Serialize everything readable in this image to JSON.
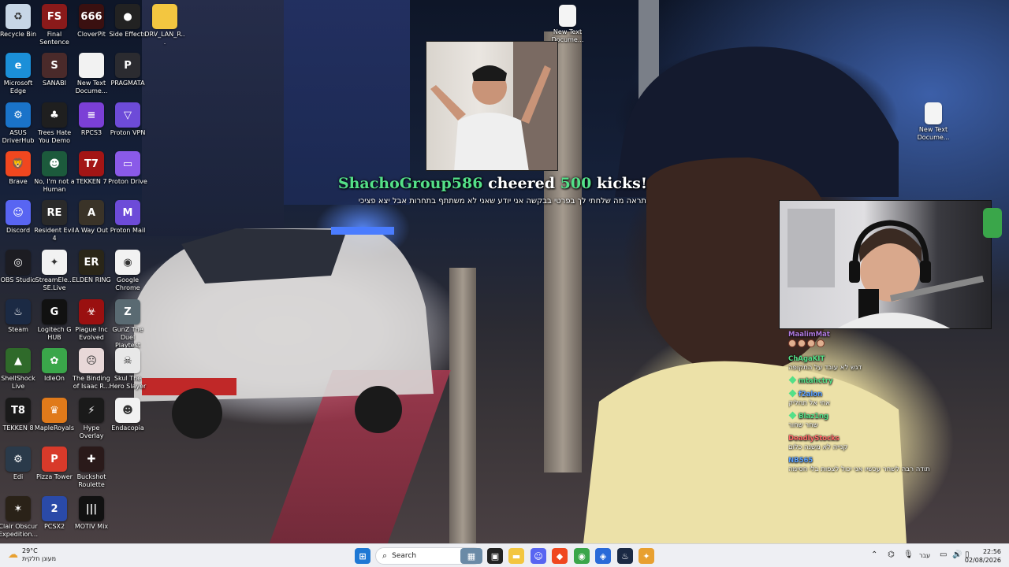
{
  "desktop_icons": [
    {
      "label": "Recycle Bin",
      "icon": "recycle-bin-icon",
      "color": "#c7d6e6",
      "glyph": "♻",
      "col": 0,
      "row": 0
    },
    {
      "label": "Final Sentence",
      "icon": "final-sentence-icon",
      "color": "#8a1a1a",
      "glyph": "FS",
      "col": 1,
      "row": 0
    },
    {
      "label": "CloverPit",
      "icon": "cloverpit-icon",
      "color": "#3a1010",
      "glyph": "666",
      "col": 2,
      "row": 0
    },
    {
      "label": "Side Effects",
      "icon": "side-effects-icon",
      "color": "#222222",
      "glyph": "●",
      "col": 3,
      "row": 0
    },
    {
      "label": "DRV_LAN_R...",
      "icon": "folder-icon",
      "color": "#f3c640",
      "glyph": "",
      "col": 4,
      "row": 0
    },
    {
      "label": "Microsoft Edge",
      "icon": "edge-icon",
      "color": "#1b8fd8",
      "glyph": "e",
      "col": 0,
      "row": 1
    },
    {
      "label": "SANABI",
      "icon": "sanabi-icon",
      "color": "#4a2a2a",
      "glyph": "S",
      "col": 1,
      "row": 1
    },
    {
      "label": "New Text Docume...",
      "icon": "text-document-icon",
      "color": "#f2f2f2",
      "glyph": "",
      "col": 2,
      "row": 1
    },
    {
      "label": "PRAGMATA",
      "icon": "pragmata-icon",
      "color": "#2b2b30",
      "glyph": "P",
      "col": 3,
      "row": 1
    },
    {
      "label": "ASUS DriverHub",
      "icon": "asus-driverhub-icon",
      "color": "#1a73c9",
      "glyph": "⚙",
      "col": 0,
      "row": 2
    },
    {
      "label": "Trees Hate You Demo",
      "icon": "trees-hate-you-icon",
      "color": "#1f1f1f",
      "glyph": "♣",
      "col": 1,
      "row": 2
    },
    {
      "label": "RPCS3",
      "icon": "rpcs3-icon",
      "color": "#7b3fd6",
      "glyph": "≡",
      "col": 2,
      "row": 2
    },
    {
      "label": "Proton VPN",
      "icon": "proton-vpn-icon",
      "color": "#6d4bd8",
      "glyph": "▽",
      "col": 3,
      "row": 2
    },
    {
      "label": "Brave",
      "icon": "brave-icon",
      "color": "#f0471f",
      "glyph": "🦁",
      "col": 0,
      "row": 3
    },
    {
      "label": "No, I'm not a Human",
      "icon": "no-im-not-human-icon",
      "color": "#1c5a3c",
      "glyph": "☻",
      "col": 1,
      "row": 3
    },
    {
      "label": "TEKKEN 7",
      "icon": "tekken7-icon",
      "color": "#a31515",
      "glyph": "T7",
      "col": 2,
      "row": 3
    },
    {
      "label": "Proton Drive",
      "icon": "proton-drive-icon",
      "color": "#8a5ae8",
      "glyph": "▭",
      "col": 3,
      "row": 3
    },
    {
      "label": "Discord",
      "icon": "discord-icon",
      "color": "#5865f2",
      "glyph": "☺",
      "col": 0,
      "row": 4
    },
    {
      "label": "Resident Evil 4",
      "icon": "resident-evil4-icon",
      "color": "#2a2a2a",
      "glyph": "RE",
      "col": 1,
      "row": 4
    },
    {
      "label": "A Way Out",
      "icon": "a-way-out-icon",
      "color": "#3a3328",
      "glyph": "A",
      "col": 2,
      "row": 4
    },
    {
      "label": "Proton Mail",
      "icon": "proton-mail-icon",
      "color": "#6d4bd8",
      "glyph": "M",
      "col": 3,
      "row": 4
    },
    {
      "label": "OBS Studio",
      "icon": "obs-studio-icon",
      "color": "#1c1c22",
      "glyph": "◎",
      "col": 0,
      "row": 5
    },
    {
      "label": "StreamEle... SE.Live",
      "icon": "streamelements-icon",
      "color": "#f2f2f2",
      "glyph": "✦",
      "col": 1,
      "row": 5
    },
    {
      "label": "ELDEN RING",
      "icon": "elden-ring-icon",
      "color": "#2a2618",
      "glyph": "ER",
      "col": 2,
      "row": 5
    },
    {
      "label": "Google Chrome",
      "icon": "chrome-icon",
      "color": "#f2f2f2",
      "glyph": "◉",
      "col": 3,
      "row": 5
    },
    {
      "label": "Steam",
      "icon": "steam-icon",
      "color": "#1b2a44",
      "glyph": "♨",
      "col": 0,
      "row": 6
    },
    {
      "label": "Logitech G HUB",
      "icon": "logitech-ghub-icon",
      "color": "#111111",
      "glyph": "G",
      "col": 1,
      "row": 6
    },
    {
      "label": "Plague Inc Evolved",
      "icon": "plague-inc-icon",
      "color": "#9a1010",
      "glyph": "☣",
      "col": 2,
      "row": 6
    },
    {
      "label": "GunZ The Duel Playtest",
      "icon": "gunz-icon",
      "color": "#5a6a72",
      "glyph": "Z",
      "col": 3,
      "row": 6
    },
    {
      "label": "ShellShock Live",
      "icon": "shellshock-live-icon",
      "color": "#2f6a2a",
      "glyph": "▲",
      "col": 0,
      "row": 7
    },
    {
      "label": "IdleOn",
      "icon": "idleon-icon",
      "color": "#3aa64a",
      "glyph": "✿",
      "col": 1,
      "row": 7
    },
    {
      "label": "The Binding of Isaac R...",
      "icon": "binding-of-isaac-icon",
      "color": "#e8d8d8",
      "glyph": "☹",
      "col": 2,
      "row": 7
    },
    {
      "label": "Skul The Hero Slayer",
      "icon": "skul-icon",
      "color": "#e8e8e8",
      "glyph": "☠",
      "col": 3,
      "row": 7
    },
    {
      "label": "TEKKEN 8",
      "icon": "tekken8-icon",
      "color": "#1a1a1a",
      "glyph": "T8",
      "col": 0,
      "row": 8
    },
    {
      "label": "MapleRoyals",
      "icon": "mapleroyals-icon",
      "color": "#e07a1a",
      "glyph": "♛",
      "col": 1,
      "row": 8
    },
    {
      "label": "Hype Overlay",
      "icon": "hype-overlay-icon",
      "color": "#1a1a1a",
      "glyph": "⚡",
      "col": 2,
      "row": 8
    },
    {
      "label": "Endacopia",
      "icon": "endacopia-icon",
      "color": "#f2f2f2",
      "glyph": "☻",
      "col": 3,
      "row": 8
    },
    {
      "label": "Edi",
      "icon": "edi-icon",
      "color": "#2a3a4a",
      "glyph": "⚙",
      "col": 0,
      "row": 9
    },
    {
      "label": "Pizza Tower",
      "icon": "pizza-tower-icon",
      "color": "#d83a2a",
      "glyph": "P",
      "col": 1,
      "row": 9
    },
    {
      "label": "Buckshot Roulette",
      "icon": "buckshot-roulette-icon",
      "color": "#2a1a1a",
      "glyph": "✚",
      "col": 2,
      "row": 9
    },
    {
      "label": "Clair Obscur Expedition...",
      "icon": "clair-obscur-icon",
      "color": "#2a2218",
      "glyph": "✶",
      "col": 0,
      "row": 10
    },
    {
      "label": "PCSX2",
      "icon": "pcsx2-icon",
      "color": "#2a4aa8",
      "glyph": "2",
      "col": 1,
      "row": 10
    },
    {
      "label": "MOTIV Mix",
      "icon": "motiv-mix-icon",
      "color": "#111111",
      "glyph": "|||",
      "col": 2,
      "row": 10
    }
  ],
  "extra_icons": [
    {
      "label": "New Text Docume...",
      "icon": "text-document-icon"
    },
    {
      "label": "New Text Docume...",
      "icon": "text-document-icon"
    }
  ],
  "cheer": {
    "user": "ShachoGroup586",
    "word1": "cheered",
    "amount": "500",
    "word2": "kicks!",
    "message": "תראה מה שלחתי לך בפרטי בבקשה אני יודע שאני לא משתתף בתחרות אבל יצא פציכי"
  },
  "chat": [
    {
      "user": "MaalimMat",
      "color": "#b07ae0",
      "text": "",
      "emotes": 4,
      "badge": false
    },
    {
      "user": "ChAgaKIT",
      "color": "#54e088",
      "text": "דגש לא עובד על התקופה",
      "emotes": 0,
      "badge": false
    },
    {
      "user": "mtahctry",
      "color": "#54e088",
      "text": "",
      "emotes": 0,
      "badge": true
    },
    {
      "user": "f2alon",
      "color": "#5aa0ff",
      "text": "אחי אל תחליק",
      "emotes": 0,
      "badge": true
    },
    {
      "user": "Blaz1ng",
      "color": "#54e088",
      "text": "שחר שחור",
      "emotes": 0,
      "badge": true
    },
    {
      "user": "DeadlyStocks",
      "color": "#ff6a6a",
      "text": "קנייה לא משנה כלום",
      "emotes": 0,
      "badge": false
    },
    {
      "user": "NB565",
      "color": "#5aa0ff",
      "text": "תודה רבה לשחר עכשיו אני יכול לצפות בלי חסימה",
      "emotes": 0,
      "badge": false
    }
  ],
  "taskbar": {
    "search_placeholder": "Search",
    "weather_temp": "29°C",
    "weather_desc": "מעונן חלקית",
    "language": "עבר",
    "time": "22:56",
    "date": "02/08/2026",
    "apps": [
      {
        "icon": "start-icon",
        "color": "#1e78d4",
        "glyph": "⊞"
      },
      {
        "icon": "widgets-icon",
        "color": "#6a8aa6",
        "glyph": "▦"
      },
      {
        "icon": "task-view-icon",
        "color": "#222222",
        "glyph": "▣"
      },
      {
        "icon": "file-explorer-icon",
        "color": "#f3c640",
        "glyph": "▬"
      },
      {
        "icon": "discord-taskbar-icon",
        "color": "#5865f2",
        "glyph": "☺"
      },
      {
        "icon": "brave-taskbar-icon",
        "color": "#f0471f",
        "glyph": "◆"
      },
      {
        "icon": "chrome-taskbar-icon",
        "color": "#3aa64a",
        "glyph": "◉"
      },
      {
        "icon": "app-taskbar-icon",
        "color": "#2a6ad8",
        "glyph": "◈"
      },
      {
        "icon": "steam-taskbar-icon",
        "color": "#1b2a44",
        "glyph": "♨"
      },
      {
        "icon": "streamelements-taskbar-icon",
        "color": "#e8a030",
        "glyph": "✦"
      }
    ]
  }
}
